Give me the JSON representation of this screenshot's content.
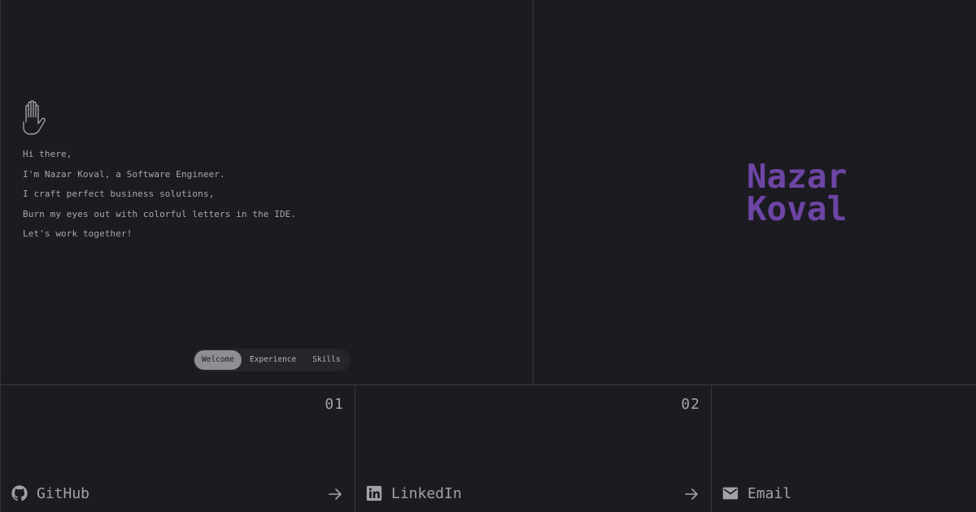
{
  "intro": {
    "lines": [
      "Hi there,",
      "I'm Nazar Koval, a Software Engineer.",
      "I craft perfect business solutions,",
      "Burn my eyes out with colorful letters in the IDE.",
      "Let's work together!"
    ],
    "icon": "raised-hand-icon"
  },
  "tabs": [
    {
      "label": "Welcome",
      "active": true
    },
    {
      "label": "Experience",
      "active": false
    },
    {
      "label": "Skills",
      "active": false
    }
  ],
  "name": {
    "first": "Nazar",
    "last": "Koval",
    "color": "#6d45a5"
  },
  "links": [
    {
      "number": "01",
      "label": "GitHub",
      "icon": "github-icon"
    },
    {
      "number": "02",
      "label": "LinkedIn",
      "icon": "linkedin-icon"
    },
    {
      "number": "",
      "label": "Email",
      "icon": "mail-icon"
    }
  ],
  "colors": {
    "background": "#1c1b21",
    "border": "#3a3944",
    "text": "#a8a7ae",
    "accent": "#6d45a5"
  }
}
